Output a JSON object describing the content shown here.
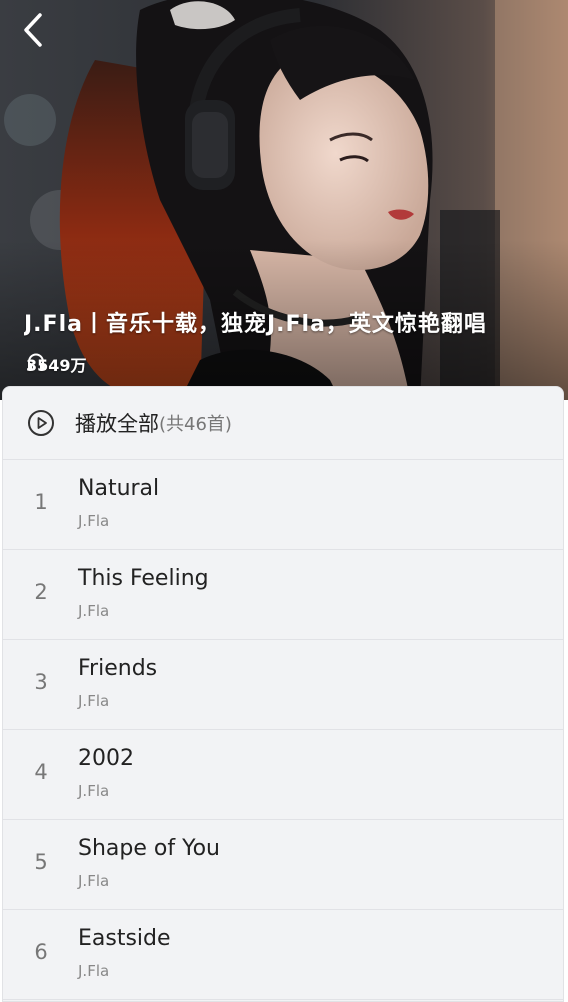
{
  "header": {
    "title": "J.Fla丨音乐十载，独宠J.Fla，英文惊艳翻唱",
    "play_count": "3549万"
  },
  "play_all": {
    "label": "播放全部",
    "count": "(共46首)"
  },
  "tracks": [
    {
      "index": "1",
      "name": "Natural",
      "artist": "J.Fla"
    },
    {
      "index": "2",
      "name": "This Feeling",
      "artist": "J.Fla"
    },
    {
      "index": "3",
      "name": "Friends",
      "artist": "J.Fla"
    },
    {
      "index": "4",
      "name": "2002",
      "artist": "J.Fla"
    },
    {
      "index": "5",
      "name": "Shape of You",
      "artist": "J.Fla"
    },
    {
      "index": "6",
      "name": "Eastside",
      "artist": "J.Fla"
    }
  ],
  "icons": {
    "back": "chevron-left-icon",
    "plays": "headphone-icon",
    "play_all": "play-circle-icon"
  },
  "colors": {
    "panel_background": "#f2f3f5",
    "primary_text": "#222222",
    "secondary_text": "#888888"
  }
}
